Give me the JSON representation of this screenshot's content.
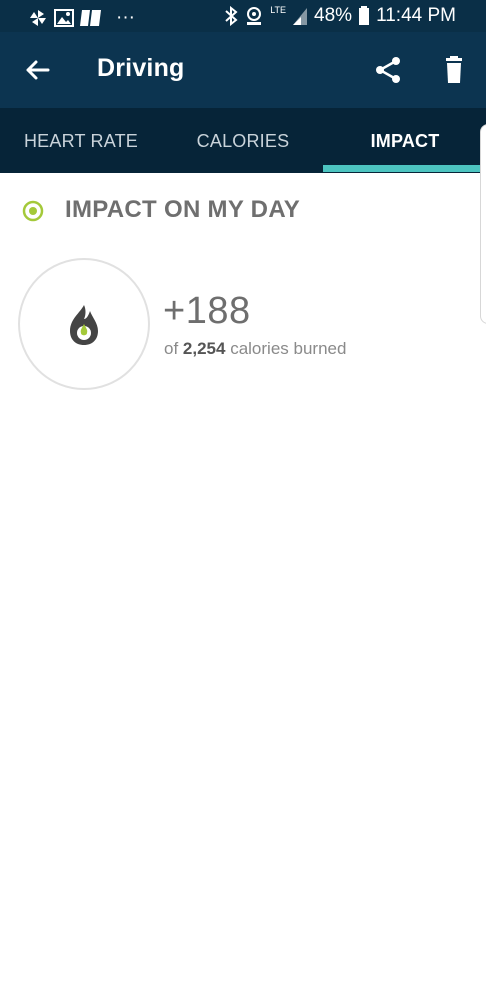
{
  "status_bar": {
    "dots": "···",
    "battery_percent": "48%",
    "time": "11:44 PM",
    "network": "LTE",
    "icons": [
      "pinwheel-icon",
      "image-icon",
      "card-icon",
      "bluetooth-icon",
      "cast-icon",
      "signal-icon",
      "battery-icon"
    ]
  },
  "app_bar": {
    "title": "Driving",
    "icons": [
      "back-arrow-icon",
      "share-icon",
      "trash-icon"
    ]
  },
  "tabs": {
    "items": [
      {
        "label": "HEART RATE",
        "active": false
      },
      {
        "label": "CALORIES",
        "active": false
      },
      {
        "label": "IMPACT",
        "active": true
      }
    ],
    "accent_color": "#4cc4c0"
  },
  "impact": {
    "section_title": "IMPACT ON MY DAY",
    "section_icon": "target-dot-icon",
    "section_icon_color": "#a4c93a",
    "value": "+188",
    "sub_prefix": "of",
    "total": "2,254",
    "sub_suffix": "calories burned",
    "icon": "flame-icon"
  },
  "colors": {
    "status_bar": "#0a2f47",
    "app_bar": "#0c3450",
    "tab_bar": "#062438"
  }
}
